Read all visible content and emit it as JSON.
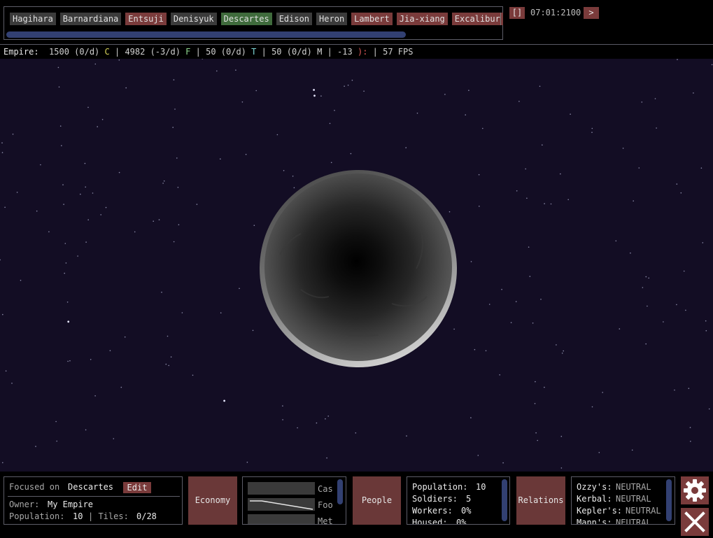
{
  "planet_tabs": [
    {
      "label": "Hagihara",
      "state": "normal"
    },
    {
      "label": "Barnardiana",
      "state": "normal"
    },
    {
      "label": "Entsuji",
      "state": "red"
    },
    {
      "label": "Denisyuk",
      "state": "normal"
    },
    {
      "label": "Descartes",
      "state": "green"
    },
    {
      "label": "Edison",
      "state": "normal"
    },
    {
      "label": "Heron",
      "state": "normal"
    },
    {
      "label": "Lambert",
      "state": "red"
    },
    {
      "label": "Jia-xiang",
      "state": "red"
    },
    {
      "label": "Excalibur",
      "state": "red"
    }
  ],
  "time": {
    "pause_label": "[]",
    "clock": "07:01:2100",
    "speed_label": ">"
  },
  "resources": {
    "label": "Empire:",
    "credits": "1500 (0/d)",
    "credits_code": "C",
    "food": "4982 (-3/d)",
    "food_code": "F",
    "tech": "50 (0/d)",
    "tech_code": "T",
    "metal": "50 (0/d)",
    "metal_code": "M",
    "happiness": "-13",
    "happiness_code": "):",
    "fps": "57 FPS",
    "sep": "|"
  },
  "focus": {
    "focused_label": "Focused on",
    "planet_name": "Descartes",
    "edit_label": "Edit",
    "owner_label": "Owner:",
    "owner_value": "My Empire",
    "population_label": "Population:",
    "population_value": "10",
    "tiles_label": "| Tiles:",
    "tiles_value": "0/28"
  },
  "economy": {
    "button_label": "Economy",
    "rows": [
      "Cas",
      "Foo",
      "Met"
    ]
  },
  "people": {
    "button_label": "People",
    "rows": [
      {
        "label": "Population:",
        "value": "10"
      },
      {
        "label": "Soldiers:",
        "value": "5"
      },
      {
        "label": "Workers:",
        "value": "0%"
      },
      {
        "label": "Housed:",
        "value": "0%"
      }
    ]
  },
  "relations": {
    "button_label": "Relations",
    "rows": [
      {
        "label": "Ozzy's:",
        "value": "NEUTRAL"
      },
      {
        "label": "Kerbal:",
        "value": "NEUTRAL"
      },
      {
        "label": "Kepler's:",
        "value": "NEUTRAL"
      },
      {
        "label": "Mann's:",
        "value": "NEUTRAL"
      }
    ]
  },
  "icons": {
    "settings": "gear-icon",
    "close": "close-icon"
  },
  "colors": {
    "button_red": "#7a3b3b",
    "tab_green": "#3f6b3c",
    "space_bg": "#130d24"
  }
}
